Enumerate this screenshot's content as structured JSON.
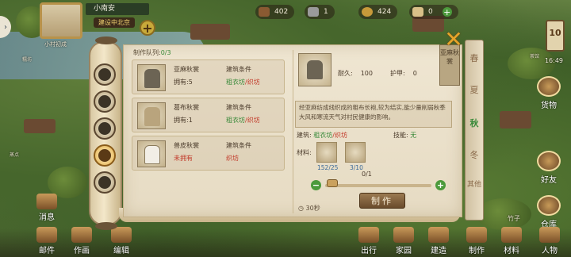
{
  "hud": {
    "village_name": "小南安",
    "village_status": "建设中北京",
    "village_sub": "小村初成",
    "resources": [
      {
        "icon": "wood-icon",
        "value": "402",
        "color": "#8a5a32"
      },
      {
        "icon": "stone-icon",
        "value": "1",
        "color": "#9a9a9a"
      },
      {
        "icon": "coin-icon",
        "value": "424",
        "color": "#c89a3a"
      },
      {
        "icon": "scroll-icon",
        "value": "0",
        "color": "#d9c089"
      }
    ],
    "day": "10",
    "time": "16:49",
    "side_buttons": [
      "货物",
      "好友",
      "仓库",
      "人物"
    ],
    "side_small_labels": [
      "竹子"
    ],
    "bottom_buttons": [
      "消息",
      "邮件",
      "作画",
      "编辑",
      "出行",
      "家园",
      "建造",
      "制作",
      "材料"
    ],
    "map_labels": [
      "糯坊",
      "蒸点",
      "茶馆"
    ]
  },
  "dialog": {
    "queue_label": "制作队列:",
    "queue_value": "0/3",
    "items": [
      {
        "name": "亚麻秋裳",
        "owned_label": "拥有:5",
        "req_label": "建筑条件",
        "req_value_a": "粗衣坊",
        "req_value_b": "/织坊",
        "state": "owned"
      },
      {
        "name": "葛布秋裳",
        "owned_label": "拥有:1",
        "req_label": "建筑条件",
        "req_value_a": "粗衣坊",
        "req_value_b": "/织坊",
        "state": "owned"
      },
      {
        "name": "兽皮秋裳",
        "owned_label": "未拥有",
        "req_label": "建筑条件",
        "req_value_a": "",
        "req_value_b": "织坊",
        "state": "missing"
      }
    ],
    "detail": {
      "tag_text": "亚麻秋裳",
      "durability_label": "耐久:",
      "durability_value": "100",
      "armor_label": "护甲:",
      "armor_value": "0",
      "description": "经亚麻纺成线织成的粗布长袍,较为结实,能少量削弱秋季大风和寒流天气对村民健康的影响。",
      "building_label": "建筑:",
      "building_value_a": "粗衣坊",
      "building_value_b": "/织坊",
      "skill_label": "技能:",
      "skill_value": "无",
      "materials_label": "材料:",
      "materials": [
        {
          "icon": "flax-icon",
          "count": "152/25"
        },
        {
          "icon": "thread-icon",
          "count": "3/10"
        }
      ],
      "quantity": "0/1",
      "make_label": "制作",
      "time": "30秒"
    },
    "seasons": [
      "春",
      "夏",
      "秋",
      "冬",
      "其他"
    ],
    "active_season": "秋"
  }
}
